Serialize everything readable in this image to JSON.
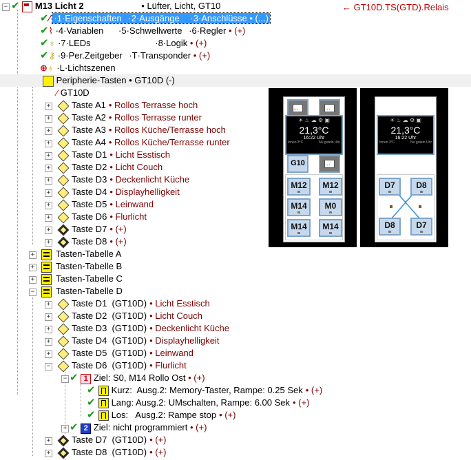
{
  "header_note": "← GT10D.TS(GTD).Relais",
  "root": {
    "module": "M13",
    "name": "Licht 2",
    "desc": "• Lüfter, Licht, GT10"
  },
  "menu": {
    "row1": [
      "·1·Eigenschaften",
      "·2·Ausgänge",
      "·3·Anschlüsse • (...)"
    ],
    "row2": [
      "·4·Variablen",
      "·5·Schwellwerte",
      "·6·Regler",
      "• (+)"
    ],
    "row3": [
      "·7·LEDs",
      "·8·Logik",
      "• (+)"
    ],
    "row4": [
      "·9·Per.Zeitgeber",
      "·T·Transponder",
      "• (+)"
    ],
    "row5": [
      "·L·Lichtszenen"
    ]
  },
  "peripherie": {
    "label": "Peripherie-Tasten",
    "value": "• GT10D (-)"
  },
  "device": "GT10D",
  "keys": [
    {
      "label": "Taste A1",
      "value": "• Rollos Terrasse hoch"
    },
    {
      "label": "Taste A2",
      "value": "• Rollos Terrasse runter"
    },
    {
      "label": "Taste A3",
      "value": "• Rollos Küche/Terrasse hoch"
    },
    {
      "label": "Taste A4",
      "value": "• Rollos Küche/Terrasse runter"
    },
    {
      "label": "Taste D1",
      "value": "• Licht Esstisch"
    },
    {
      "label": "Taste D2",
      "value": "• Licht Couch"
    },
    {
      "label": "Taste D3",
      "value": "• Deckenlicht Küche"
    },
    {
      "label": "Taste D4",
      "value": "• Displayhelligkeit"
    },
    {
      "label": "Taste D5",
      "value": "• Leinwand"
    },
    {
      "label": "Taste D6",
      "value": "• Flurlicht"
    },
    {
      "label": "Taste D7",
      "value": "• (+)"
    },
    {
      "label": "Taste D8",
      "value": "• (+)"
    }
  ],
  "tables": [
    "Tasten-Tabelle A",
    "Tasten-Tabelle B",
    "Tasten-Tabelle C",
    "Tasten-Tabelle D"
  ],
  "tableD": [
    {
      "label": "Taste D1  (GT10D)",
      "value": "• Licht Esstisch"
    },
    {
      "label": "Taste D2  (GT10D)",
      "value": "• Licht Couch"
    },
    {
      "label": "Taste D3  (GT10D)",
      "value": "• Deckenlicht Küche"
    },
    {
      "label": "Taste D4  (GT10D)",
      "value": "• Displayhelligkeit"
    },
    {
      "label": "Taste D5  (GT10D)",
      "value": "• Leinwand"
    },
    {
      "label": "Taste D6  (GT10D)",
      "value": "• Flurlicht"
    }
  ],
  "ziel1": {
    "num": "1",
    "text": "Ziel: S0, M14 Rollo Ost",
    "plus": "• (+)"
  },
  "actions": [
    {
      "text": "Kurz:  Ausg.2: Memory-Taster, Rampe: 0.25 Sek",
      "plus": "• (+)"
    },
    {
      "text": "Lang: Ausg.2: UMschalten, Rampe: 6.00 Sek",
      "plus": "• (+)"
    },
    {
      "text": "Los:   Ausg.2: Rampe stop",
      "plus": "• (+)"
    }
  ],
  "ziel2": {
    "num": "2",
    "text": "Ziel: nicht programmiert",
    "plus": "• (+)"
  },
  "tableD_tail": [
    {
      "label": "Taste D7  (GT10D)",
      "value": "• (+)"
    },
    {
      "label": "Taste D8  (GT10D)",
      "value": "• (+)"
    }
  ],
  "panel_left": {
    "temp": "21,3°C",
    "time": "16:22 Uhr",
    "g10": "G10",
    "dots": "...",
    "buttons": [
      "M12",
      "M12",
      "M14",
      "M0",
      "M14",
      "M14"
    ],
    "footer_left": "Innen  3°C",
    "footer_right": "Nu gutein Uhr"
  },
  "panel_right": {
    "temp": "21,3°C",
    "time": "16:22 Uhr",
    "buttons": [
      "D7",
      "D8",
      "D8",
      "D7"
    ],
    "footer_left": "Innen  3°C",
    "footer_right": "Nu gutein Uhr"
  }
}
